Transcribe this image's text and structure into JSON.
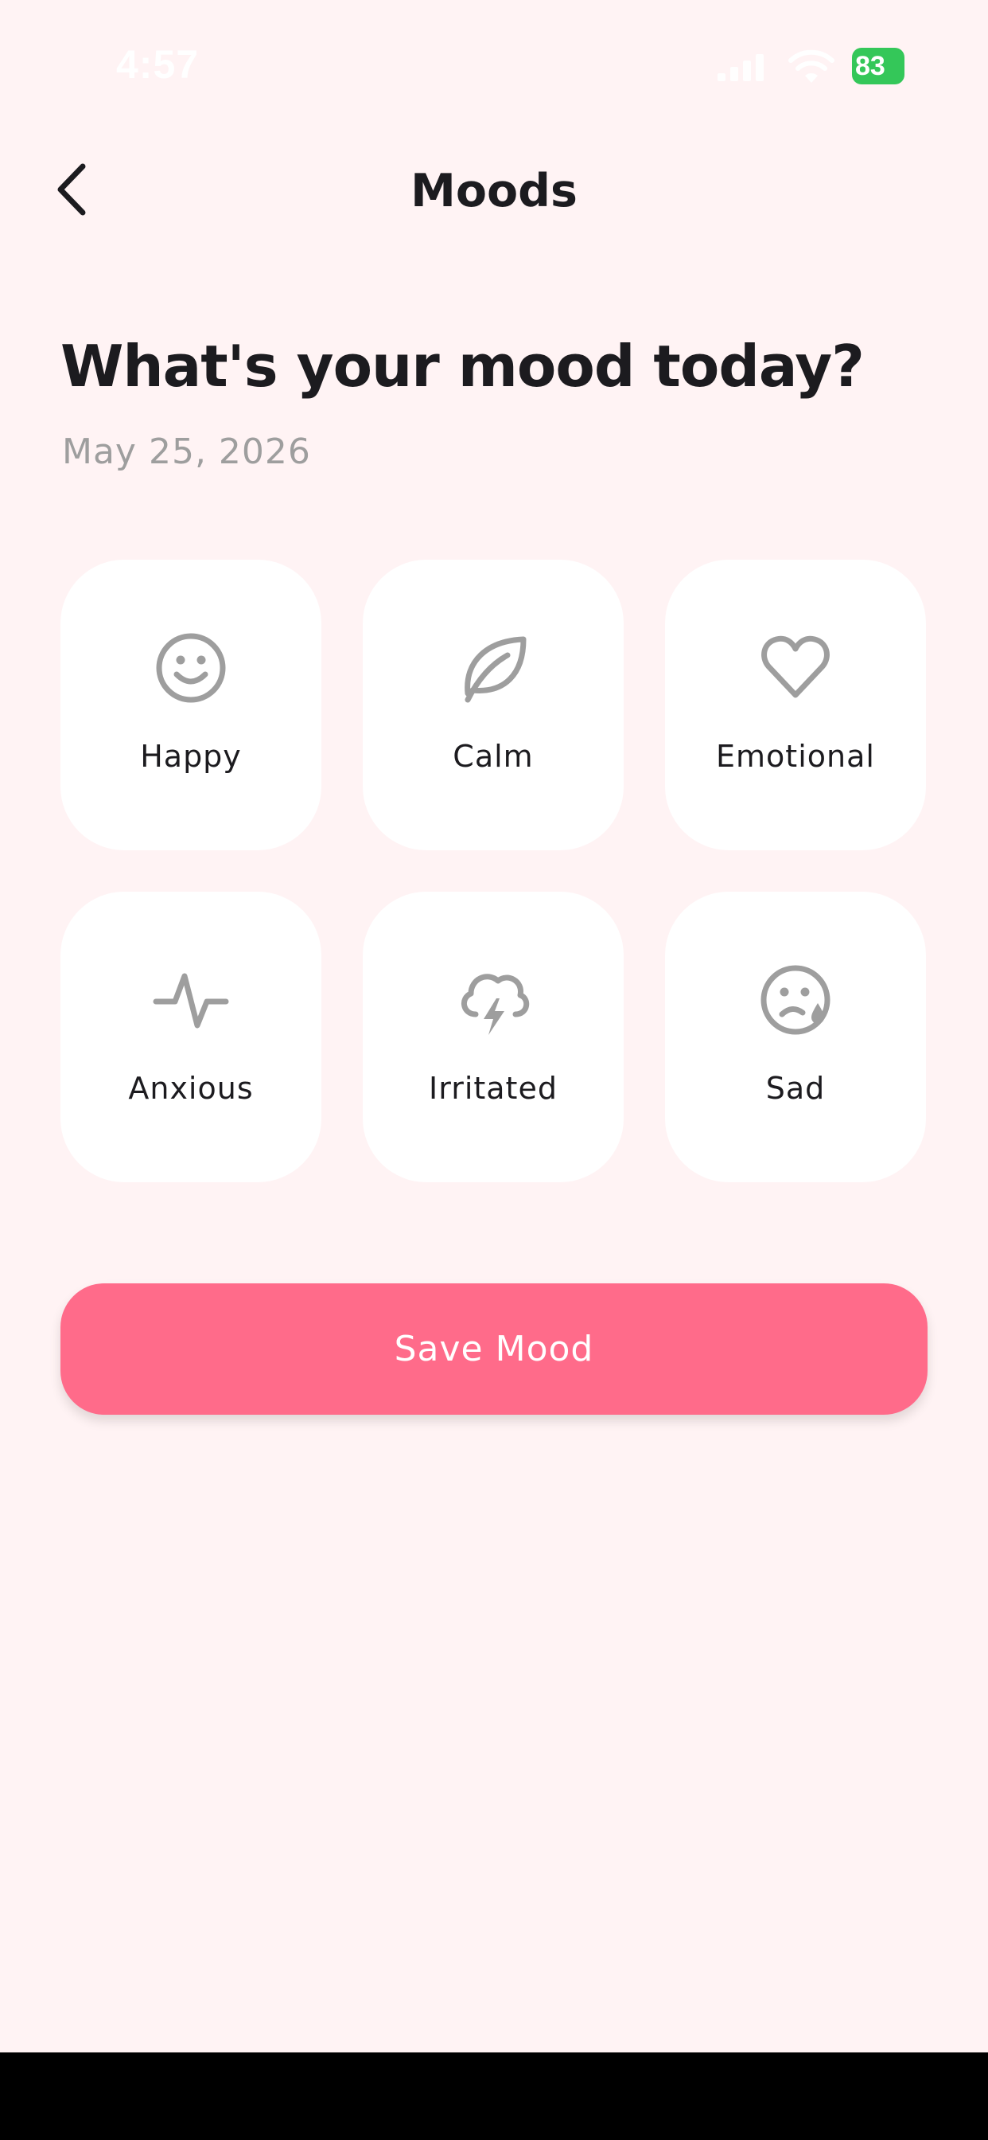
{
  "status_bar": {
    "time": "4:57",
    "battery": "83",
    "battery_color": "#34C759"
  },
  "header": {
    "title": "Moods",
    "back_icon": "chevron-left-icon"
  },
  "question": "What's your mood today?",
  "date": "May 25, 2026",
  "moods": [
    {
      "label": "Happy",
      "icon": "smile-icon"
    },
    {
      "label": "Calm",
      "icon": "leaf-icon"
    },
    {
      "label": "Emotional",
      "icon": "heart-icon"
    },
    {
      "label": "Anxious",
      "icon": "pulse-icon"
    },
    {
      "label": "Irritated",
      "icon": "storm-cloud-icon"
    },
    {
      "label": "Sad",
      "icon": "sad-tear-icon"
    }
  ],
  "save_button": {
    "label": "Save Mood"
  },
  "colors": {
    "background": "#FFF3F4",
    "card": "#FFFFFF",
    "accent": "#FF6B8A",
    "icon": "#9E9E9E",
    "text": "#1C1B1F"
  }
}
